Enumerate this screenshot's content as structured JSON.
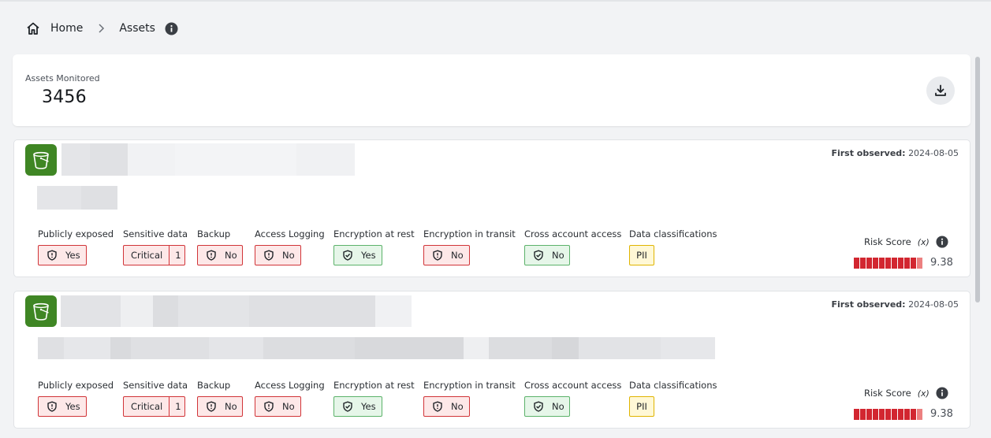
{
  "breadcrumb": {
    "home": "Home",
    "current": "Assets"
  },
  "summary": {
    "label": "Assets Monitored",
    "count": "3456"
  },
  "attribute_labels": {
    "public": "Publicly exposed",
    "sensitive": "Sensitive data",
    "backup": "Backup",
    "logging": "Access Logging",
    "enc_rest": "Encryption at rest",
    "enc_transit": "Encryption in transit",
    "cross_account": "Cross account access",
    "classifications": "Data classifications",
    "risk": "Risk Score",
    "fx": "(x)"
  },
  "assets": [
    {
      "first_observed_label": "First observed:",
      "first_observed": "2024-08-05",
      "public": "Yes",
      "sensitive": "Critical",
      "sensitive_count": "1",
      "backup": "No",
      "logging": "No",
      "enc_rest": "Yes",
      "enc_transit": "No",
      "cross_account": "No",
      "classification": "PII",
      "risk_score": "9.38",
      "risk_fraction": 0.938
    },
    {
      "first_observed_label": "First observed:",
      "first_observed": "2024-08-05",
      "public": "Yes",
      "sensitive": "Critical",
      "sensitive_count": "1",
      "backup": "No",
      "logging": "No",
      "enc_rest": "Yes",
      "enc_transit": "No",
      "cross_account": "No",
      "classification": "PII",
      "risk_score": "9.38",
      "risk_fraction": 0.938
    }
  ],
  "colors": {
    "bad": "#d13438",
    "good": "#5cb26a",
    "warn": "#e0b400",
    "bucket": "#3f8624",
    "risk": "#d22630"
  },
  "icons": {
    "home": "home-icon",
    "chevron": "chevron-right-icon",
    "info": "info-icon",
    "download": "download-icon",
    "bucket": "s3-bucket-icon",
    "shield": "shield-icon",
    "shield_check": "shield-check-icon"
  }
}
